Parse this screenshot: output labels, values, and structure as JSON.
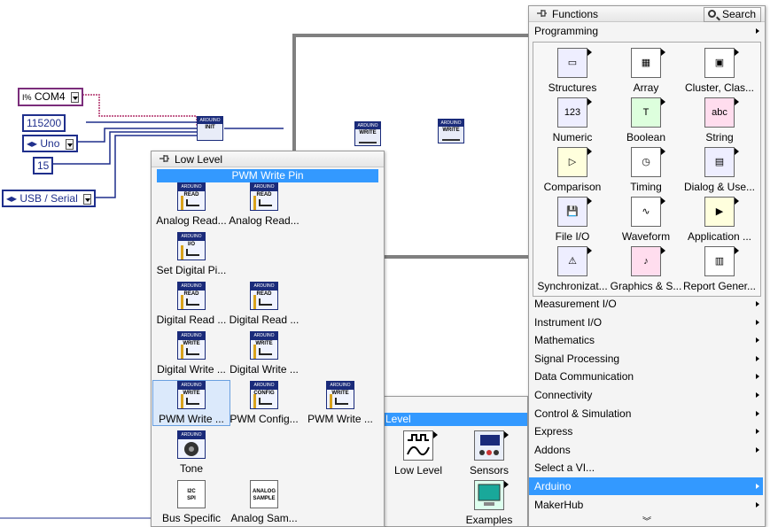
{
  "diagram": {
    "com_port": "COM4",
    "baud": "115200",
    "board": "Uno",
    "bytes": "15",
    "connection": "USB / Serial",
    "init_label": "INIT",
    "write_label": "WRITE",
    "vi_header": "ARDUINO"
  },
  "low_level": {
    "title": "Low Level",
    "highlight": "PWM Write Pin",
    "items": [
      {
        "label": "Analog Read...",
        "glyph": "READ"
      },
      {
        "label": "Analog Read...",
        "glyph": "READ"
      },
      {
        "label": "Set Digital Pi...",
        "glyph": "I/O"
      },
      {
        "label": "Digital Read ...",
        "glyph": "READ"
      },
      {
        "label": "Digital Read ...",
        "glyph": "READ"
      },
      {
        "label": "Digital Write ...",
        "glyph": "WRITE"
      },
      {
        "label": "Digital Write ...",
        "glyph": "WRITE"
      },
      {
        "label": "PWM Write ...",
        "glyph": "WRITE"
      },
      {
        "label": "PWM Config...",
        "glyph": "CONFIG"
      },
      {
        "label": "PWM Write ...",
        "glyph": "WRITE"
      },
      {
        "label": "Tone",
        "glyph": ""
      },
      {
        "label": "Bus Specific",
        "glyph": "I2C SPI"
      },
      {
        "label": "Analog Sam...",
        "glyph": "ANALOG SAMPLE"
      }
    ]
  },
  "arduino_palette": {
    "title_fragment": "Level",
    "items": [
      {
        "label": "Low Level"
      },
      {
        "label": "Sensors"
      },
      {
        "label": "Examples"
      }
    ]
  },
  "functions": {
    "title": "Functions",
    "search_label": "Search",
    "category": "Programming",
    "tiles": [
      {
        "label": "Structures",
        "icon": "structures-icon"
      },
      {
        "label": "Array",
        "icon": "array-icon"
      },
      {
        "label": "Cluster, Clas...",
        "icon": "cluster-icon"
      },
      {
        "label": "Numeric",
        "icon": "numeric-icon"
      },
      {
        "label": "Boolean",
        "icon": "boolean-icon"
      },
      {
        "label": "String",
        "icon": "string-icon"
      },
      {
        "label": "Comparison",
        "icon": "comparison-icon"
      },
      {
        "label": "Timing",
        "icon": "timing-icon"
      },
      {
        "label": "Dialog & Use...",
        "icon": "dialog-icon"
      },
      {
        "label": "File I/O",
        "icon": "file-io-icon"
      },
      {
        "label": "Waveform",
        "icon": "waveform-icon"
      },
      {
        "label": "Application ...",
        "icon": "application-icon"
      },
      {
        "label": "Synchronizat...",
        "icon": "sync-icon"
      },
      {
        "label": "Graphics & S...",
        "icon": "graphics-icon"
      },
      {
        "label": "Report Gener...",
        "icon": "report-icon"
      }
    ],
    "menu": [
      {
        "label": "Measurement I/O",
        "submenu": true
      },
      {
        "label": "Instrument I/O",
        "submenu": true
      },
      {
        "label": "Mathematics",
        "submenu": true
      },
      {
        "label": "Signal Processing",
        "submenu": true
      },
      {
        "label": "Data Communication",
        "submenu": true
      },
      {
        "label": "Connectivity",
        "submenu": true
      },
      {
        "label": "Control & Simulation",
        "submenu": true
      },
      {
        "label": "Express",
        "submenu": true
      },
      {
        "label": "Addons",
        "submenu": true
      },
      {
        "label": "Select a VI...",
        "submenu": false
      },
      {
        "label": "Arduino",
        "submenu": true,
        "active": true
      },
      {
        "label": "MakerHub",
        "submenu": true
      }
    ],
    "colors": {
      "selection": "#3399ff",
      "wire_pink": "#b0306a",
      "wire_blue": "#1f2f8c",
      "frame_gray": "#808080"
    }
  }
}
